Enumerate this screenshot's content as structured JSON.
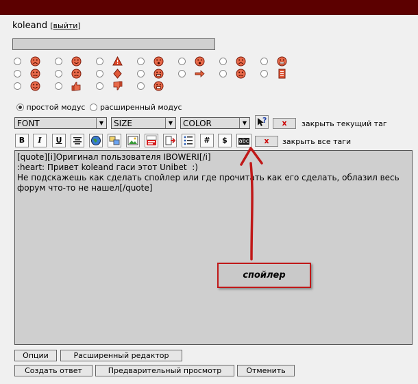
{
  "user": {
    "name": "koleand",
    "bracket_open": "[",
    "logout": "выйти",
    "bracket_close": "]"
  },
  "smileys": [
    {
      "icon": "angry-smiley-icon",
      "col": 0,
      "row": 0
    },
    {
      "icon": "happy-smiley-icon",
      "col": 1,
      "row": 0
    },
    {
      "icon": "warning-icon",
      "col": 2,
      "row": 0
    },
    {
      "icon": "question-smiley-icon",
      "col": 3,
      "row": 0
    },
    {
      "icon": "shocked-smiley-icon",
      "col": 4,
      "row": 0
    },
    {
      "icon": "sad-smiley-icon",
      "col": 5,
      "row": 0
    },
    {
      "icon": "laughing-smiley-icon",
      "col": 6,
      "row": 0
    },
    {
      "icon": "crying-smiley-icon",
      "col": 0,
      "row": 1
    },
    {
      "icon": "frown-smiley-icon",
      "col": 1,
      "row": 1
    },
    {
      "icon": "diamond-icon",
      "col": 2,
      "row": 1
    },
    {
      "icon": "grimace-smiley-icon",
      "col": 3,
      "row": 1
    },
    {
      "icon": "arrow-right-icon",
      "col": 4,
      "row": 1
    },
    {
      "icon": "unhappy-smiley-icon",
      "col": 5,
      "row": 1
    },
    {
      "icon": "notepad-icon",
      "col": 6,
      "row": 1
    },
    {
      "icon": "blush-smiley-icon",
      "col": 0,
      "row": 2
    },
    {
      "icon": "thumbs-up-icon",
      "col": 1,
      "row": 2
    },
    {
      "icon": "thumbs-down-icon",
      "col": 2,
      "row": 2
    },
    {
      "icon": "grin-smiley-icon",
      "col": 3,
      "row": 2
    }
  ],
  "modes": {
    "simple": "простой модус",
    "advanced": "расширенный модус",
    "selected": "simple"
  },
  "toolbar": {
    "font": "FONT",
    "size": "SIZE",
    "color": "COLOR",
    "help": "?",
    "close_x": "x",
    "close_current": "закрыть текущий таг",
    "close_all": "закрыть все таги",
    "bold": "B",
    "italic": "I",
    "underline": "U",
    "hash": "#",
    "dollar": "$",
    "spoiler": "abc"
  },
  "editor": {
    "text": "[quote][i]Оригинал пользователя IBOWERI[/i]\n:heart: Привет koleand гаси этот Unibet  :)\nНе подскажешь как сделать спойлер или где прочитать как его сделать, облазил весь форум что-то не нашел[/quote]"
  },
  "annotation": {
    "label": "спойлер",
    "color": "#c01818"
  },
  "buttons": {
    "options": "Опции",
    "advanced_editor": "Расширенный редактор",
    "submit": "Создать ответ",
    "preview": "Предварительный просмотр",
    "cancel": "Отменить"
  },
  "colors": {
    "topbar": "#5c0000",
    "editor_bg": "#cfcfcf",
    "page_bg": "#f0f0f0",
    "close_x": "#cc0000"
  }
}
